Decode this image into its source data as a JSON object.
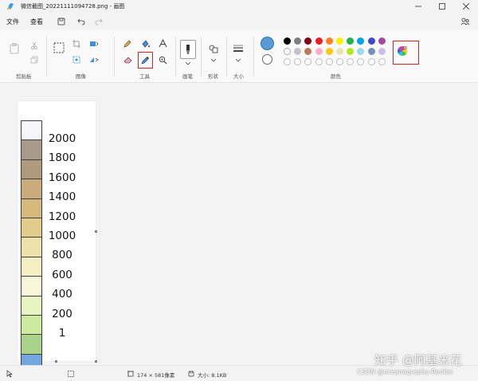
{
  "window": {
    "title": "微信截图_20221111094728.png - 画图"
  },
  "menu": {
    "file": "文件",
    "view": "查看"
  },
  "ribbon": {
    "groups": {
      "clipboard": "剪贴板",
      "image": "图像",
      "tools": "工具",
      "brushes": "画笔",
      "shapes": "形状",
      "size": "大小",
      "colors": "颜色"
    },
    "palette_row1": [
      "#000000",
      "#7f7f7f",
      "#880015",
      "#ed1c24",
      "#ff7f27",
      "#fff200",
      "#22b14c",
      "#00a2e8",
      "#3f48cc",
      "#a349a4"
    ],
    "palette_row2": [
      "#ffffff",
      "#c3c3c3",
      "#b97a57",
      "#ffaec9",
      "#ffc90e",
      "#efe4b0",
      "#b5e61d",
      "#99d9ea",
      "#7092be",
      "#c8bfe7"
    ],
    "primary_color": "#5b9bd5",
    "secondary_color": "#ffffff"
  },
  "canvas": {
    "legend_colors": [
      "#f7f7fb",
      "#a89a8c",
      "#b09a7e",
      "#c9ab7c",
      "#d5b87c",
      "#e3cc8b",
      "#ede0aa",
      "#f6efc5",
      "#faf6d9",
      "#e6f5c3",
      "#cdeaa0",
      "#abd289",
      "#73a7e0"
    ],
    "legend_labels": [
      "2000",
      "1800",
      "1600",
      "1400",
      "1200",
      "1000",
      "800",
      "600",
      "400",
      "200",
      "1"
    ]
  },
  "status": {
    "dimensions": "174 × 581像素",
    "file_size": "大小: 8.1KB"
  },
  "watermark": {
    "line1": "知乎 @阿基米花",
    "line2": "CSDN @oceanography-Rookie"
  }
}
